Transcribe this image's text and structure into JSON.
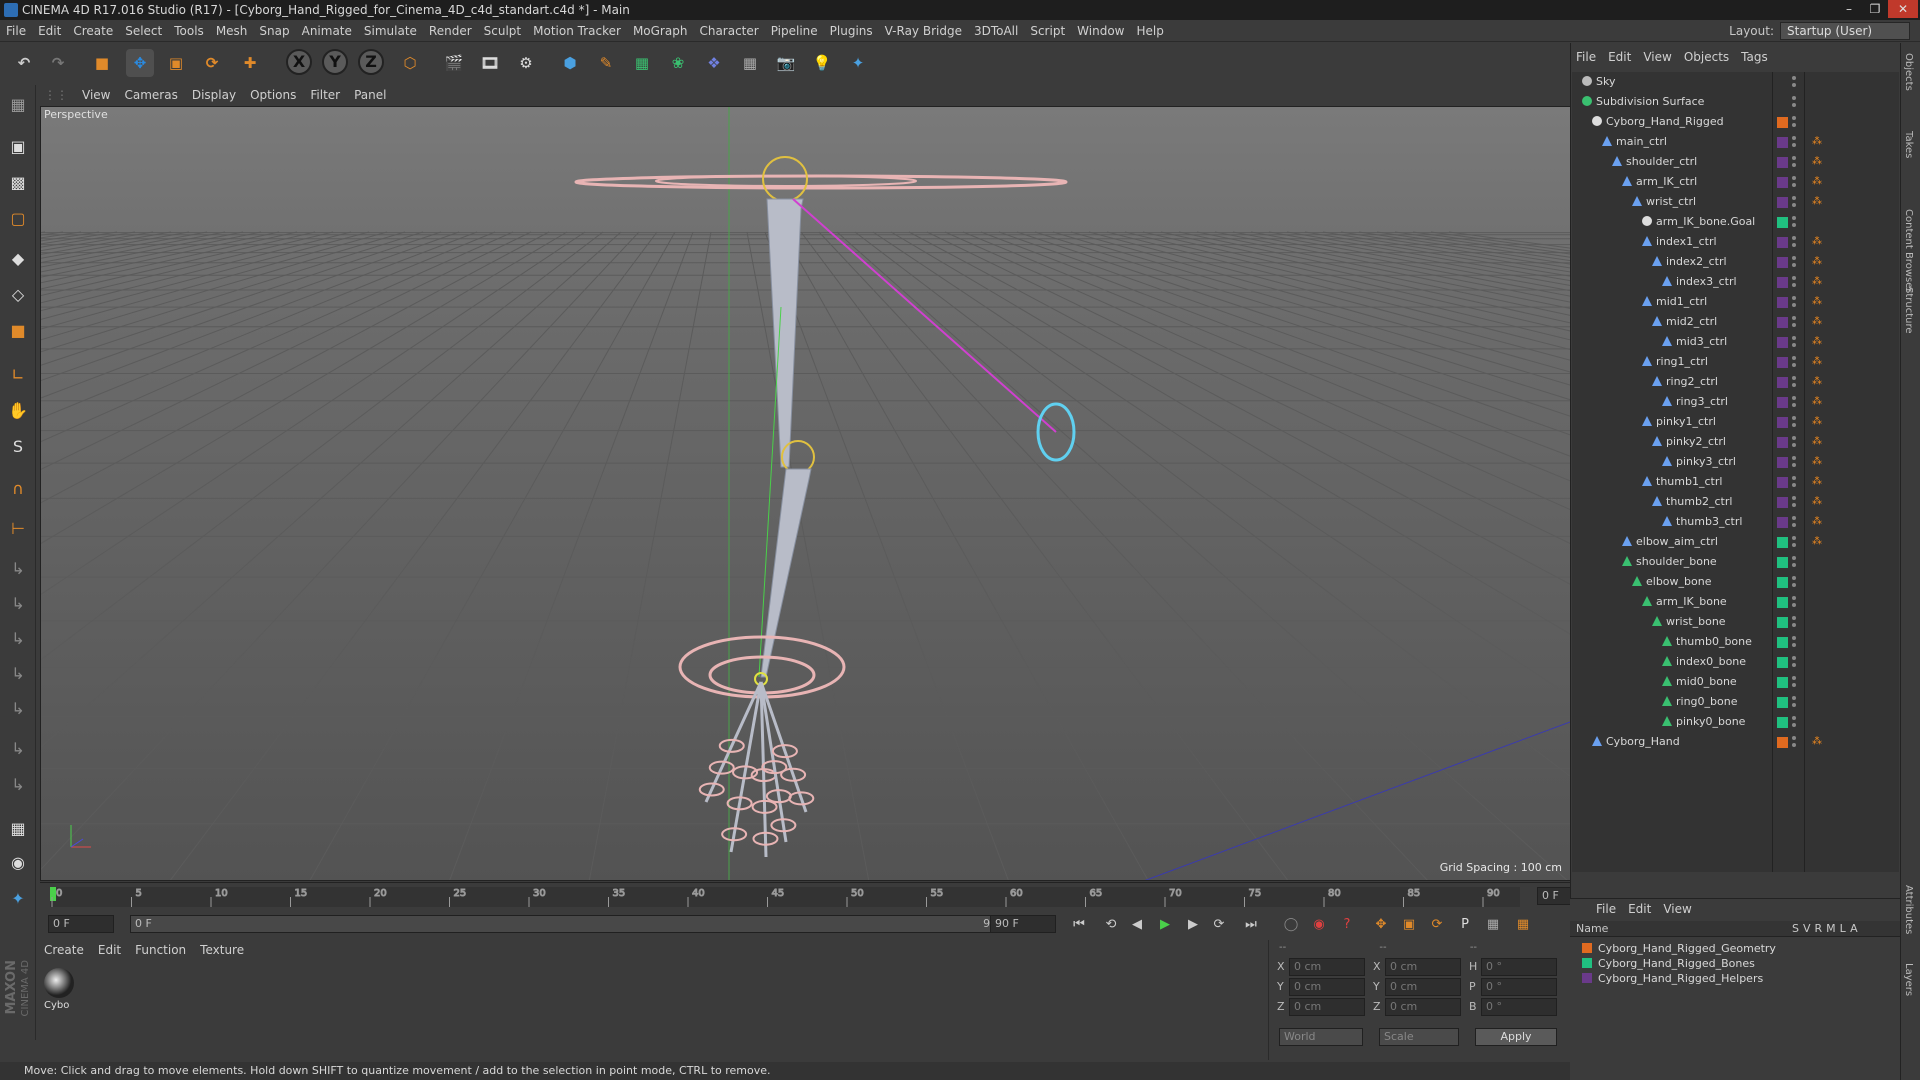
{
  "window": {
    "title": "CINEMA 4D R17.016 Studio (R17) - [Cyborg_Hand_Rigged_for_Cinema_4D_c4d_standart.c4d *] - Main"
  },
  "menubar": [
    "File",
    "Edit",
    "Create",
    "Select",
    "Tools",
    "Mesh",
    "Snap",
    "Animate",
    "Simulate",
    "Render",
    "Sculpt",
    "Motion Tracker",
    "MoGraph",
    "Character",
    "Pipeline",
    "Plugins",
    "V-Ray Bridge",
    "3DToAll",
    "Script",
    "Window",
    "Help"
  ],
  "layout": {
    "label": "Layout:",
    "value": "Startup (User)"
  },
  "viewport": {
    "menu": [
      "View",
      "Cameras",
      "Display",
      "Options",
      "Filter",
      "Panel"
    ],
    "camera_label": "Perspective",
    "grid_spacing": "Grid Spacing : 100 cm"
  },
  "timeline": {
    "ticks": [
      "0",
      "5",
      "10",
      "15",
      "20",
      "25",
      "30",
      "35",
      "40",
      "45",
      "50",
      "55",
      "60",
      "65",
      "70",
      "75",
      "80",
      "85",
      "90"
    ],
    "current_frame": "0 F",
    "start_field": "0 F",
    "range_start": "0 F",
    "range_end": "90 F",
    "end_field": "90 F"
  },
  "material_manager": {
    "menu": [
      "Create",
      "Edit",
      "Function",
      "Texture"
    ],
    "materials": [
      {
        "label": "Cybo"
      }
    ]
  },
  "coords": {
    "headers": [
      "--",
      "--",
      "--"
    ],
    "rows": [
      {
        "a": "X",
        "av": "0 cm",
        "b": "X",
        "bv": "0 cm",
        "c": "H",
        "cv": "0 °"
      },
      {
        "a": "Y",
        "av": "0 cm",
        "b": "Y",
        "bv": "0 cm",
        "c": "P",
        "cv": "0 °"
      },
      {
        "a": "Z",
        "av": "0 cm",
        "b": "Z",
        "bv": "0 cm",
        "c": "B",
        "cv": "0 °"
      }
    ],
    "space": "World",
    "mode": "Scale",
    "apply": "Apply"
  },
  "status": "Move: Click and drag to move elements. Hold down SHIFT to quantize movement / add to the selection in point mode, CTRL to remove.",
  "object_manager": {
    "menu": [
      "File",
      "Edit",
      "View",
      "Objects",
      "Tags"
    ],
    "objects": [
      {
        "name": "Sky",
        "depth": 0,
        "color": "",
        "kind": "sky"
      },
      {
        "name": "Subdivision Surface",
        "depth": 0,
        "color": "",
        "kind": "subd"
      },
      {
        "name": "Cyborg_Hand_Rigged",
        "depth": 1,
        "color": "#e06a20",
        "kind": "null"
      },
      {
        "name": "main_ctrl",
        "depth": 2,
        "color": "#6a3a8a",
        "kind": "joint"
      },
      {
        "name": "shoulder_ctrl",
        "depth": 3,
        "color": "#6a3a8a",
        "kind": "joint"
      },
      {
        "name": "arm_IK_ctrl",
        "depth": 4,
        "color": "#6a3a8a",
        "kind": "joint"
      },
      {
        "name": "wrist_ctrl",
        "depth": 5,
        "color": "#6a3a8a",
        "kind": "joint"
      },
      {
        "name": "arm_IK_bone.Goal",
        "depth": 6,
        "color": "#20c080",
        "kind": "null"
      },
      {
        "name": "index1_ctrl",
        "depth": 6,
        "color": "#6a3a8a",
        "kind": "joint"
      },
      {
        "name": "index2_ctrl",
        "depth": 7,
        "color": "#6a3a8a",
        "kind": "joint"
      },
      {
        "name": "index3_ctrl",
        "depth": 8,
        "color": "#6a3a8a",
        "kind": "joint"
      },
      {
        "name": "mid1_ctrl",
        "depth": 6,
        "color": "#6a3a8a",
        "kind": "joint"
      },
      {
        "name": "mid2_ctrl",
        "depth": 7,
        "color": "#6a3a8a",
        "kind": "joint"
      },
      {
        "name": "mid3_ctrl",
        "depth": 8,
        "color": "#6a3a8a",
        "kind": "joint"
      },
      {
        "name": "ring1_ctrl",
        "depth": 6,
        "color": "#6a3a8a",
        "kind": "joint"
      },
      {
        "name": "ring2_ctrl",
        "depth": 7,
        "color": "#6a3a8a",
        "kind": "joint"
      },
      {
        "name": "ring3_ctrl",
        "depth": 8,
        "color": "#6a3a8a",
        "kind": "joint"
      },
      {
        "name": "pinky1_ctrl",
        "depth": 6,
        "color": "#6a3a8a",
        "kind": "joint"
      },
      {
        "name": "pinky2_ctrl",
        "depth": 7,
        "color": "#6a3a8a",
        "kind": "joint"
      },
      {
        "name": "pinky3_ctrl",
        "depth": 8,
        "color": "#6a3a8a",
        "kind": "joint"
      },
      {
        "name": "thumb1_ctrl",
        "depth": 6,
        "color": "#6a3a8a",
        "kind": "joint"
      },
      {
        "name": "thumb2_ctrl",
        "depth": 7,
        "color": "#6a3a8a",
        "kind": "joint"
      },
      {
        "name": "thumb3_ctrl",
        "depth": 8,
        "color": "#6a3a8a",
        "kind": "joint"
      },
      {
        "name": "elbow_aim_ctrl",
        "depth": 4,
        "color": "#20c080",
        "kind": "joint"
      },
      {
        "name": "shoulder_bone",
        "depth": 4,
        "color": "#20c080",
        "kind": "bone"
      },
      {
        "name": "elbow_bone",
        "depth": 5,
        "color": "#20c080",
        "kind": "bone"
      },
      {
        "name": "arm_IK_bone",
        "depth": 6,
        "color": "#20c080",
        "kind": "bone"
      },
      {
        "name": "wrist_bone",
        "depth": 7,
        "color": "#20c080",
        "kind": "bone"
      },
      {
        "name": "thumb0_bone",
        "depth": 8,
        "color": "#20c080",
        "kind": "bone"
      },
      {
        "name": "index0_bone",
        "depth": 8,
        "color": "#20c080",
        "kind": "bone"
      },
      {
        "name": "mid0_bone",
        "depth": 8,
        "color": "#20c080",
        "kind": "bone"
      },
      {
        "name": "ring0_bone",
        "depth": 8,
        "color": "#20c080",
        "kind": "bone"
      },
      {
        "name": "pinky0_bone",
        "depth": 8,
        "color": "#20c080",
        "kind": "bone"
      },
      {
        "name": "Cyborg_Hand",
        "depth": 1,
        "color": "#e06a20",
        "kind": "joint"
      }
    ]
  },
  "layer_manager": {
    "menu": [
      "File",
      "Edit",
      "View"
    ],
    "header": {
      "name": "Name",
      "cols": [
        "S",
        "V",
        "R",
        "M",
        "L",
        "A"
      ]
    },
    "layers": [
      {
        "name": "Cyborg_Hand_Rigged_Geometry",
        "color": "#e06a20"
      },
      {
        "name": "Cyborg_Hand_Rigged_Bones",
        "color": "#20c080"
      },
      {
        "name": "Cyborg_Hand_Rigged_Helpers",
        "color": "#6a3a8a"
      }
    ]
  },
  "right_tabs": [
    "Objects",
    "Takes",
    "Content Browser",
    "Structure",
    "Attributes",
    "Layers"
  ],
  "brand": {
    "line1": "MAXON",
    "line2": "CINEMA 4D"
  }
}
